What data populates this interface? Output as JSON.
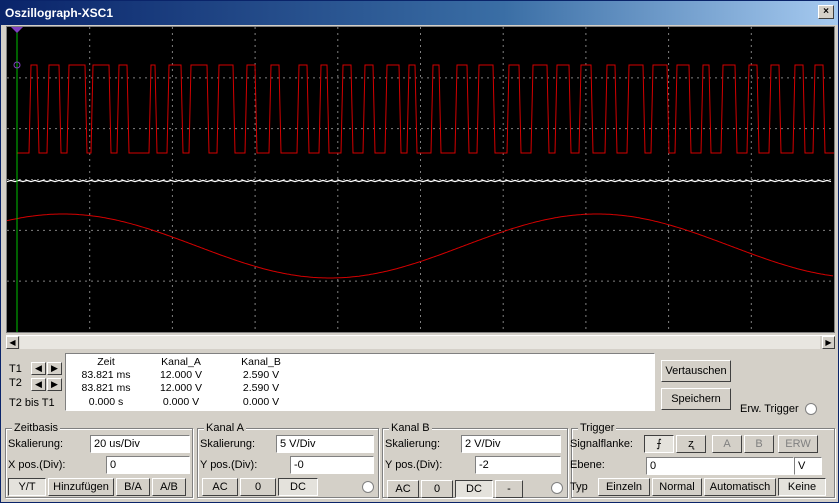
{
  "window": {
    "title": "Oszillograph-XSC1",
    "close": "×"
  },
  "cursor_labels": {
    "t1": "T1",
    "t2": "T2",
    "t2_minus_t1": "T2 bis T1"
  },
  "readout": {
    "headers": [
      "Zeit",
      "Kanal_A",
      "Kanal_B"
    ],
    "rows": [
      [
        "83.821 ms",
        "12.000 V",
        "2.590 V"
      ],
      [
        "83.821 ms",
        "12.000 V",
        "2.590 V"
      ],
      [
        "0.000 s",
        "0.000 V",
        "0.000 V"
      ]
    ]
  },
  "buttons": {
    "swap": "Vertauschen",
    "save": "Speichern",
    "ext_trigger": "Erw. Trigger"
  },
  "timebase": {
    "title": "Zeitbasis",
    "scale_label": "Skalierung:",
    "scale_value": "20 us/Div",
    "xpos_label": "X pos.(Div):",
    "xpos_value": "0",
    "modes": [
      "Y/T",
      "Hinzufügen",
      "B/A",
      "A/B"
    ],
    "active_mode": "Y/T"
  },
  "channel_a": {
    "title": "Kanal A",
    "scale_label": "Skalierung:",
    "scale_value": "5  V/Div",
    "ypos_label": "Y pos.(Div):",
    "ypos_value": "-0",
    "coupling": [
      "AC",
      "0",
      "DC"
    ],
    "active_coupling": "DC"
  },
  "channel_b": {
    "title": "Kanal B",
    "scale_label": "Skalierung:",
    "scale_value": "2  V/Div",
    "ypos_label": "Y pos.(Div):",
    "ypos_value": "-2",
    "coupling": [
      "AC",
      "0",
      "DC",
      "-"
    ],
    "active_coupling": "DC"
  },
  "trigger": {
    "title": "Trigger",
    "edge_label": "Signalflanke:",
    "edge_rising": "⨍",
    "edge_falling": "ʐ",
    "sources": [
      "A",
      "B",
      "ERW"
    ],
    "level_label": "Ebene:",
    "level_value": "0",
    "level_unit": "V",
    "type_label": "Typ",
    "types": [
      "Einzeln",
      "Normal",
      "Automatisch",
      "Keine"
    ],
    "active_type": "Keine"
  },
  "colors": {
    "trace_a": "#d40000",
    "trace_b": "#ffffff",
    "grid": "#808080",
    "cursor": "#00c000"
  }
}
